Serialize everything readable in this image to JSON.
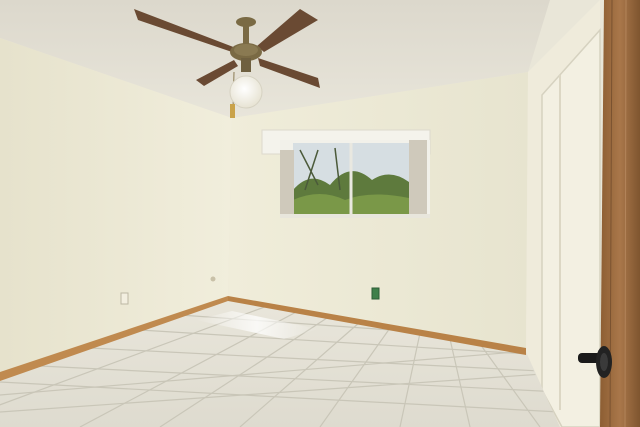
{
  "scene": {
    "subject": "empty bedroom",
    "elements": [
      "ceiling-fan",
      "light-globe",
      "window",
      "closet-door",
      "door",
      "door-handle",
      "wall-outlet",
      "tile-floor",
      "baseboard"
    ]
  },
  "colors": {
    "ceiling": "#e4e1d6",
    "left_wall": "#ece9d6",
    "back_wall": "#ebe8d4",
    "right_wall": "#efebdb",
    "floor": "#e7e4d8",
    "grout": "#c9c6b8",
    "baseboard": "#c08a4f",
    "fan_blade": "#6a4a33",
    "fan_metal": "#7a6a44",
    "globe": "#fbfaf4",
    "door_wood": "#9a6a3c",
    "handle": "#1a1a1a",
    "outlet_green": "#3f7f4a",
    "window_frame": "#f2f1ea",
    "blind": "#cfc9bb",
    "foliage": "#5e7a3d",
    "sky": "#d6dee2"
  }
}
